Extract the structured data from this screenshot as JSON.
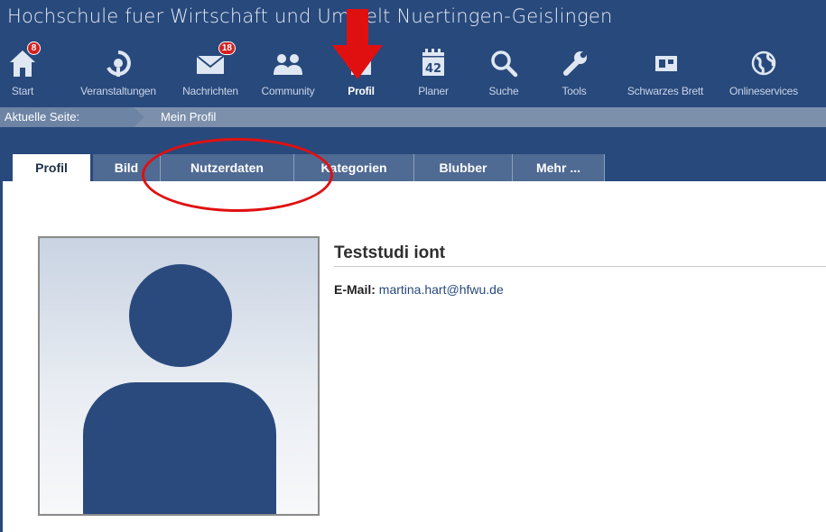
{
  "header": {
    "site_title": "Hochschule fuer Wirtschaft und Umwelt Nuertingen-Geislingen",
    "nav": [
      {
        "label": "Start",
        "icon": "home-icon",
        "badge": "8"
      },
      {
        "label": "Veranstaltungen",
        "icon": "seminar-icon",
        "badge": ""
      },
      {
        "label": "Nachrichten",
        "icon": "mail-icon",
        "badge": "18"
      },
      {
        "label": "Community",
        "icon": "community-icon",
        "badge": ""
      },
      {
        "label": "Profil",
        "icon": "profile-icon",
        "badge": "",
        "active": true
      },
      {
        "label": "Planer",
        "icon": "calendar-icon",
        "badge": "",
        "calendar_day": "42"
      },
      {
        "label": "Suche",
        "icon": "search-icon",
        "badge": ""
      },
      {
        "label": "Tools",
        "icon": "wrench-icon",
        "badge": ""
      },
      {
        "label": "Schwarzes Brett",
        "icon": "board-icon",
        "badge": ""
      },
      {
        "label": "Onlineservices",
        "icon": "globe-icon",
        "badge": ""
      }
    ]
  },
  "breadcrumb": {
    "label": "Aktuelle Seite:",
    "current": "Mein Profil"
  },
  "tabs": [
    {
      "label": "Profil",
      "active": true
    },
    {
      "label": "Bild"
    },
    {
      "label": "Nutzerdaten"
    },
    {
      "label": "Kategorien"
    },
    {
      "label": "Blubber"
    },
    {
      "label": "Mehr ..."
    }
  ],
  "profile": {
    "name": "Teststudi iont",
    "email_label": "E-Mail:",
    "email": "martina.hart@hfwu.de"
  },
  "colors": {
    "header_bg": "#28497c",
    "breadcrumb_bg": "#7c90ac",
    "tab_bg": "#4f6a93",
    "badge": "#d42020",
    "annotation": "#e01010"
  }
}
